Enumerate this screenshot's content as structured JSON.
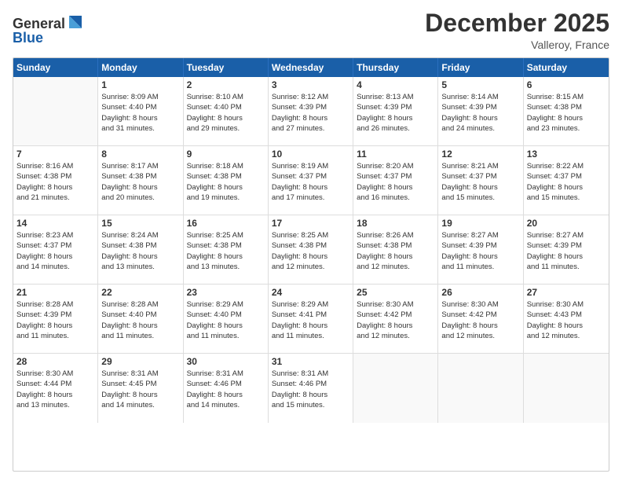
{
  "logo": {
    "line1": "General",
    "line2": "Blue"
  },
  "title": "December 2025",
  "location": "Valleroy, France",
  "header_days": [
    "Sunday",
    "Monday",
    "Tuesday",
    "Wednesday",
    "Thursday",
    "Friday",
    "Saturday"
  ],
  "weeks": [
    [
      {
        "day": "",
        "info": ""
      },
      {
        "day": "1",
        "info": "Sunrise: 8:09 AM\nSunset: 4:40 PM\nDaylight: 8 hours\nand 31 minutes."
      },
      {
        "day": "2",
        "info": "Sunrise: 8:10 AM\nSunset: 4:40 PM\nDaylight: 8 hours\nand 29 minutes."
      },
      {
        "day": "3",
        "info": "Sunrise: 8:12 AM\nSunset: 4:39 PM\nDaylight: 8 hours\nand 27 minutes."
      },
      {
        "day": "4",
        "info": "Sunrise: 8:13 AM\nSunset: 4:39 PM\nDaylight: 8 hours\nand 26 minutes."
      },
      {
        "day": "5",
        "info": "Sunrise: 8:14 AM\nSunset: 4:39 PM\nDaylight: 8 hours\nand 24 minutes."
      },
      {
        "day": "6",
        "info": "Sunrise: 8:15 AM\nSunset: 4:38 PM\nDaylight: 8 hours\nand 23 minutes."
      }
    ],
    [
      {
        "day": "7",
        "info": "Sunrise: 8:16 AM\nSunset: 4:38 PM\nDaylight: 8 hours\nand 21 minutes."
      },
      {
        "day": "8",
        "info": "Sunrise: 8:17 AM\nSunset: 4:38 PM\nDaylight: 8 hours\nand 20 minutes."
      },
      {
        "day": "9",
        "info": "Sunrise: 8:18 AM\nSunset: 4:38 PM\nDaylight: 8 hours\nand 19 minutes."
      },
      {
        "day": "10",
        "info": "Sunrise: 8:19 AM\nSunset: 4:37 PM\nDaylight: 8 hours\nand 17 minutes."
      },
      {
        "day": "11",
        "info": "Sunrise: 8:20 AM\nSunset: 4:37 PM\nDaylight: 8 hours\nand 16 minutes."
      },
      {
        "day": "12",
        "info": "Sunrise: 8:21 AM\nSunset: 4:37 PM\nDaylight: 8 hours\nand 15 minutes."
      },
      {
        "day": "13",
        "info": "Sunrise: 8:22 AM\nSunset: 4:37 PM\nDaylight: 8 hours\nand 15 minutes."
      }
    ],
    [
      {
        "day": "14",
        "info": "Sunrise: 8:23 AM\nSunset: 4:37 PM\nDaylight: 8 hours\nand 14 minutes."
      },
      {
        "day": "15",
        "info": "Sunrise: 8:24 AM\nSunset: 4:38 PM\nDaylight: 8 hours\nand 13 minutes."
      },
      {
        "day": "16",
        "info": "Sunrise: 8:25 AM\nSunset: 4:38 PM\nDaylight: 8 hours\nand 13 minutes."
      },
      {
        "day": "17",
        "info": "Sunrise: 8:25 AM\nSunset: 4:38 PM\nDaylight: 8 hours\nand 12 minutes."
      },
      {
        "day": "18",
        "info": "Sunrise: 8:26 AM\nSunset: 4:38 PM\nDaylight: 8 hours\nand 12 minutes."
      },
      {
        "day": "19",
        "info": "Sunrise: 8:27 AM\nSunset: 4:39 PM\nDaylight: 8 hours\nand 11 minutes."
      },
      {
        "day": "20",
        "info": "Sunrise: 8:27 AM\nSunset: 4:39 PM\nDaylight: 8 hours\nand 11 minutes."
      }
    ],
    [
      {
        "day": "21",
        "info": "Sunrise: 8:28 AM\nSunset: 4:39 PM\nDaylight: 8 hours\nand 11 minutes."
      },
      {
        "day": "22",
        "info": "Sunrise: 8:28 AM\nSunset: 4:40 PM\nDaylight: 8 hours\nand 11 minutes."
      },
      {
        "day": "23",
        "info": "Sunrise: 8:29 AM\nSunset: 4:40 PM\nDaylight: 8 hours\nand 11 minutes."
      },
      {
        "day": "24",
        "info": "Sunrise: 8:29 AM\nSunset: 4:41 PM\nDaylight: 8 hours\nand 11 minutes."
      },
      {
        "day": "25",
        "info": "Sunrise: 8:30 AM\nSunset: 4:42 PM\nDaylight: 8 hours\nand 12 minutes."
      },
      {
        "day": "26",
        "info": "Sunrise: 8:30 AM\nSunset: 4:42 PM\nDaylight: 8 hours\nand 12 minutes."
      },
      {
        "day": "27",
        "info": "Sunrise: 8:30 AM\nSunset: 4:43 PM\nDaylight: 8 hours\nand 12 minutes."
      }
    ],
    [
      {
        "day": "28",
        "info": "Sunrise: 8:30 AM\nSunset: 4:44 PM\nDaylight: 8 hours\nand 13 minutes."
      },
      {
        "day": "29",
        "info": "Sunrise: 8:31 AM\nSunset: 4:45 PM\nDaylight: 8 hours\nand 14 minutes."
      },
      {
        "day": "30",
        "info": "Sunrise: 8:31 AM\nSunset: 4:46 PM\nDaylight: 8 hours\nand 14 minutes."
      },
      {
        "day": "31",
        "info": "Sunrise: 8:31 AM\nSunset: 4:46 PM\nDaylight: 8 hours\nand 15 minutes."
      },
      {
        "day": "",
        "info": ""
      },
      {
        "day": "",
        "info": ""
      },
      {
        "day": "",
        "info": ""
      }
    ]
  ]
}
